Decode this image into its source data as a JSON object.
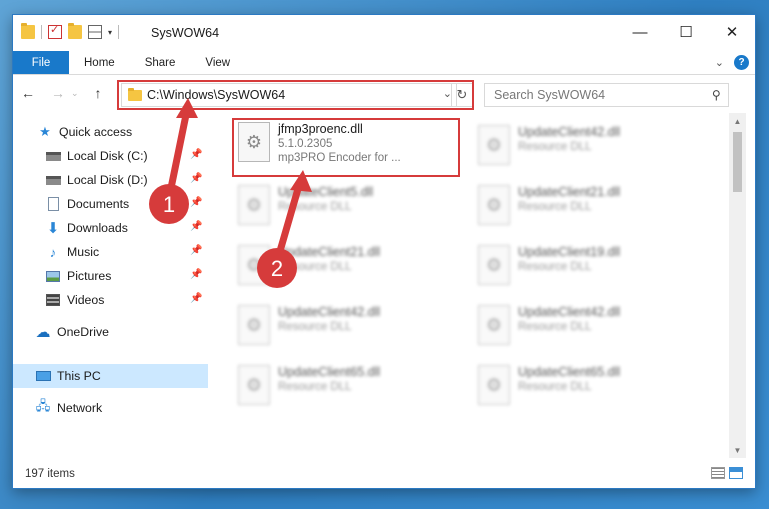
{
  "window": {
    "title": "SysWOW64",
    "controls": [
      "—",
      "☐",
      "✕"
    ]
  },
  "ribbon": {
    "tabs": [
      "File",
      "Home",
      "Share",
      "View"
    ]
  },
  "navigation": {
    "address_path": "C:\\Windows\\SysWOW64",
    "search_placeholder": "Search SysWOW64"
  },
  "sidebar": {
    "quick_access": "Quick access",
    "items": [
      {
        "label": "Local Disk (C:)",
        "icon": "drive-icon"
      },
      {
        "label": "Local Disk (D:)",
        "icon": "drive-icon"
      },
      {
        "label": "Documents",
        "icon": "documents-icon"
      },
      {
        "label": "Downloads",
        "icon": "downloads-icon"
      },
      {
        "label": "Music",
        "icon": "music-icon"
      },
      {
        "label": "Pictures",
        "icon": "pictures-icon"
      },
      {
        "label": "Videos",
        "icon": "videos-icon"
      }
    ],
    "onedrive": "OneDrive",
    "this_pc": "This PC",
    "network": "Network"
  },
  "files": {
    "highlighted": {
      "name": "jfmp3proenc.dll",
      "version": "5.1.0.2305",
      "description": "mp3PRO Encoder for ..."
    },
    "others": [
      {
        "name": "UpdateClient42.dll",
        "sub": "Resource DLL"
      },
      {
        "name": "UpdateClient5.dll",
        "sub": "Resource DLL"
      },
      {
        "name": "UpdateClient21.dll",
        "sub": "Resource DLL"
      },
      {
        "name": "UpdateClient21.dll",
        "sub": "Resource DLL"
      },
      {
        "name": "UpdateClient19.dll",
        "sub": "Resource DLL"
      },
      {
        "name": "UpdateClient42.dll",
        "sub": "Resource DLL"
      },
      {
        "name": "UpdateClient42.dll",
        "sub": "Resource DLL"
      },
      {
        "name": "UpdateClient65.dll",
        "sub": "Resource DLL"
      },
      {
        "name": "UpdateClient65.dll",
        "sub": "Resource DLL"
      }
    ]
  },
  "status": {
    "item_count": "197 items"
  },
  "annotations": {
    "step1": "1",
    "step2": "2",
    "color": "#d63b3b"
  }
}
